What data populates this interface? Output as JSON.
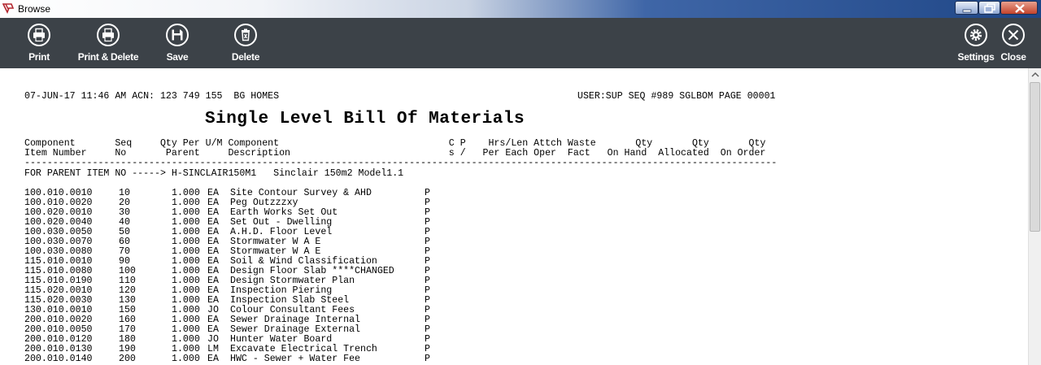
{
  "window": {
    "title": "Browse"
  },
  "toolbar": {
    "print": "Print",
    "print_delete": "Print & Delete",
    "save": "Save",
    "delete": "Delete",
    "settings": "Settings",
    "close": "Close"
  },
  "report": {
    "header_left": "07-JUN-17 11:46 AM ACN: 123 749 155  BG HOMES",
    "header_right": "USER:SUP SEQ #989 SGLBOM PAGE 00001",
    "title": "Single Level Bill Of Materials",
    "col_header_1": "Component       Seq     Qty Per U/M Component                              C P    Hrs/Len Attch Waste       Qty       Qty       Qty",
    "col_header_2": "Item Number     No       Parent     Description                            s /   Per Each Oper  Fact   On Hand  Allocated  On Order",
    "separator": "-------------------------------------------------------------------------------------------------------------------------------------",
    "parent_line": "FOR PARENT ITEM NO -----> H-SINCLAIR150M1   Sinclair 150m2 Model1.1",
    "rows": [
      {
        "item": "100.010.0010",
        "seq": "10",
        "qty": "1.000",
        "um": "EA",
        "desc": "Site Contour Survey & AHD",
        "flag": "P"
      },
      {
        "item": "100.010.0020",
        "seq": "20",
        "qty": "1.000",
        "um": "EA",
        "desc": "Peg Outzzzxy",
        "flag": "P"
      },
      {
        "item": "100.020.0010",
        "seq": "30",
        "qty": "1.000",
        "um": "EA",
        "desc": "Earth Works Set Out",
        "flag": "P"
      },
      {
        "item": "100.020.0040",
        "seq": "40",
        "qty": "1.000",
        "um": "EA",
        "desc": "Set Out - Dwelling",
        "flag": "P"
      },
      {
        "item": "100.030.0050",
        "seq": "50",
        "qty": "1.000",
        "um": "EA",
        "desc": "A.H.D. Floor Level",
        "flag": "P"
      },
      {
        "item": "100.030.0070",
        "seq": "60",
        "qty": "1.000",
        "um": "EA",
        "desc": "Stormwater W A E",
        "flag": "P"
      },
      {
        "item": "100.030.0080",
        "seq": "70",
        "qty": "1.000",
        "um": "EA",
        "desc": "Stormwater W A E",
        "flag": "P"
      },
      {
        "item": "115.010.0010",
        "seq": "90",
        "qty": "1.000",
        "um": "EA",
        "desc": "Soil & Wind Classification",
        "flag": "P"
      },
      {
        "item": "115.010.0080",
        "seq": "100",
        "qty": "1.000",
        "um": "EA",
        "desc": "Design Floor Slab ****CHANGED",
        "flag": "P"
      },
      {
        "item": "115.010.0190",
        "seq": "110",
        "qty": "1.000",
        "um": "EA",
        "desc": "Design Stormwater Plan",
        "flag": "P"
      },
      {
        "item": "115.020.0010",
        "seq": "120",
        "qty": "1.000",
        "um": "EA",
        "desc": "Inspection Piering",
        "flag": "P"
      },
      {
        "item": "115.020.0030",
        "seq": "130",
        "qty": "1.000",
        "um": "EA",
        "desc": "Inspection Slab Steel",
        "flag": "P"
      },
      {
        "item": "130.010.0010",
        "seq": "150",
        "qty": "1.000",
        "um": "JO",
        "desc": "Colour Consultant Fees",
        "flag": "P"
      },
      {
        "item": "200.010.0020",
        "seq": "160",
        "qty": "1.000",
        "um": "EA",
        "desc": "Sewer Drainage Internal",
        "flag": "P"
      },
      {
        "item": "200.010.0050",
        "seq": "170",
        "qty": "1.000",
        "um": "EA",
        "desc": "Sewer Drainage External",
        "flag": "P"
      },
      {
        "item": "200.010.0120",
        "seq": "180",
        "qty": "1.000",
        "um": "JO",
        "desc": "Hunter Water Board",
        "flag": "P"
      },
      {
        "item": "200.010.0130",
        "seq": "190",
        "qty": "1.000",
        "um": "LM",
        "desc": "Excavate Electrical Trench",
        "flag": "P"
      },
      {
        "item": "200.010.0140",
        "seq": "200",
        "qty": "1.000",
        "um": "EA",
        "desc": "HWC - Sewer + Water Fee",
        "flag": "P"
      }
    ]
  },
  "icons": {
    "print": "printer-icon",
    "print_delete": "printer-icon",
    "save": "floppy-disk-icon",
    "delete": "trash-icon",
    "settings": "gear-icon",
    "close": "close-icon"
  }
}
